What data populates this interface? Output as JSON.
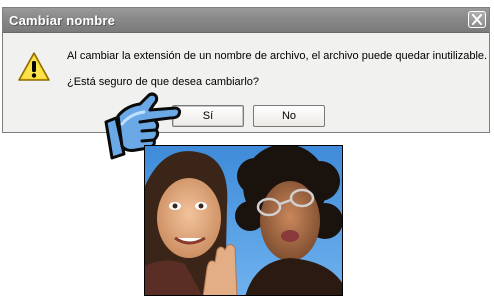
{
  "dialog": {
    "title": "Cambiar nombre",
    "message_line1": "Al cambiar la extensión de un nombre de archivo, el archivo puede quedar inutilizable.",
    "message_line2": "¿Está seguro de que desea cambiarlo?",
    "buttons": {
      "yes_label": "Sí",
      "no_label": "No"
    },
    "icons": {
      "warning": "warning-icon",
      "close": "close-icon"
    }
  },
  "overlay": {
    "hand_icon": "pointing-hand-icon",
    "photo": "photo-two-people"
  },
  "colors": {
    "titlebar": "#8c8c8c",
    "dialog_bg": "#f1f1ef",
    "warning_yellow": "#f5d21a",
    "hand_blue": "#6aa8e6"
  }
}
